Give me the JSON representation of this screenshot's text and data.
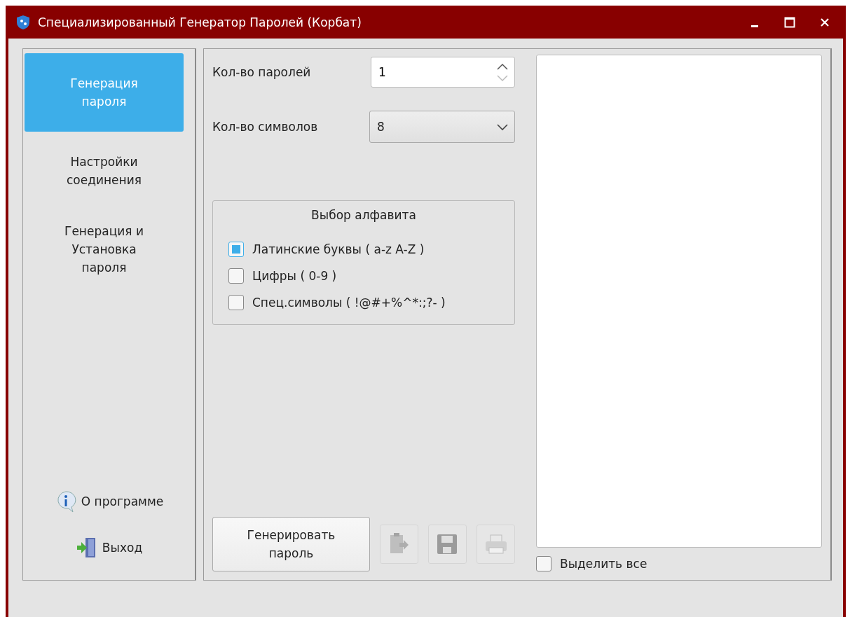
{
  "window": {
    "title": "Специализированный Генератор Паролей (Корбат)"
  },
  "sidebar": {
    "items": [
      {
        "label": "Генерация пароля",
        "selected": true
      },
      {
        "label": "Настройки соединения",
        "selected": false
      },
      {
        "label": "Генерация и Установка пароля",
        "selected": false
      }
    ],
    "about": "О программе",
    "exit": "Выход"
  },
  "password_count": {
    "label": "Кол-во паролей",
    "value": "1"
  },
  "symbol_count": {
    "label": "Кол-во символов",
    "value": "8"
  },
  "alphabet": {
    "title": "Выбор алфавита",
    "options": [
      {
        "label": "Латинские буквы ( a-z A-Z )",
        "checked": true
      },
      {
        "label": "Цифры ( 0-9 )",
        "checked": false
      },
      {
        "label": "Спец.символы ( !@#+%^*:;?- )",
        "checked": false
      }
    ]
  },
  "generate_button": "Генерировать пароль",
  "tools": [
    {
      "kind": "copy",
      "disabled": true
    },
    {
      "kind": "save",
      "disabled": true
    },
    {
      "kind": "print",
      "disabled": true
    }
  ],
  "select_all": {
    "label": "Выделить все",
    "checked": false
  }
}
